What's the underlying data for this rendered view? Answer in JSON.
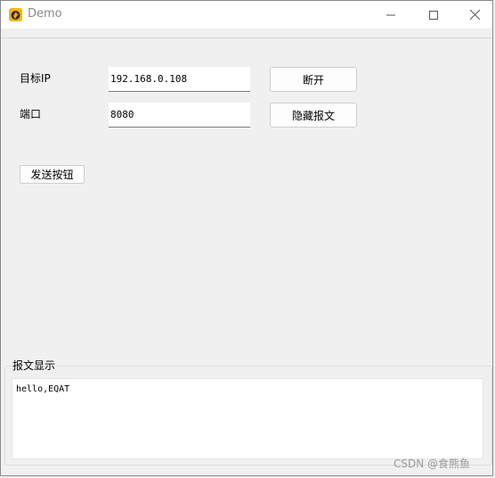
{
  "window": {
    "title": "Demo",
    "minimize_label": "Minimize",
    "maximize_label": "Maximize",
    "close_label": "Close"
  },
  "form": {
    "target_ip_label": "目标IP",
    "target_ip_value": "192.168.0.108",
    "port_label": "端口",
    "port_value": "8080",
    "disconnect_button": "断开",
    "hide_message_button": "隐藏报文",
    "send_button": "发送按钮"
  },
  "message_panel": {
    "title": "报文显示",
    "content": "hello,EQAT"
  },
  "watermark": "CSDN @食熊鱼",
  "colors": {
    "app_icon": "#f2b51d",
    "window_background": "#f0f0f0"
  },
  "icons": {
    "app": "app-logo-icon",
    "minimize": "minimize-icon",
    "maximize": "maximize-icon",
    "close": "close-icon"
  }
}
